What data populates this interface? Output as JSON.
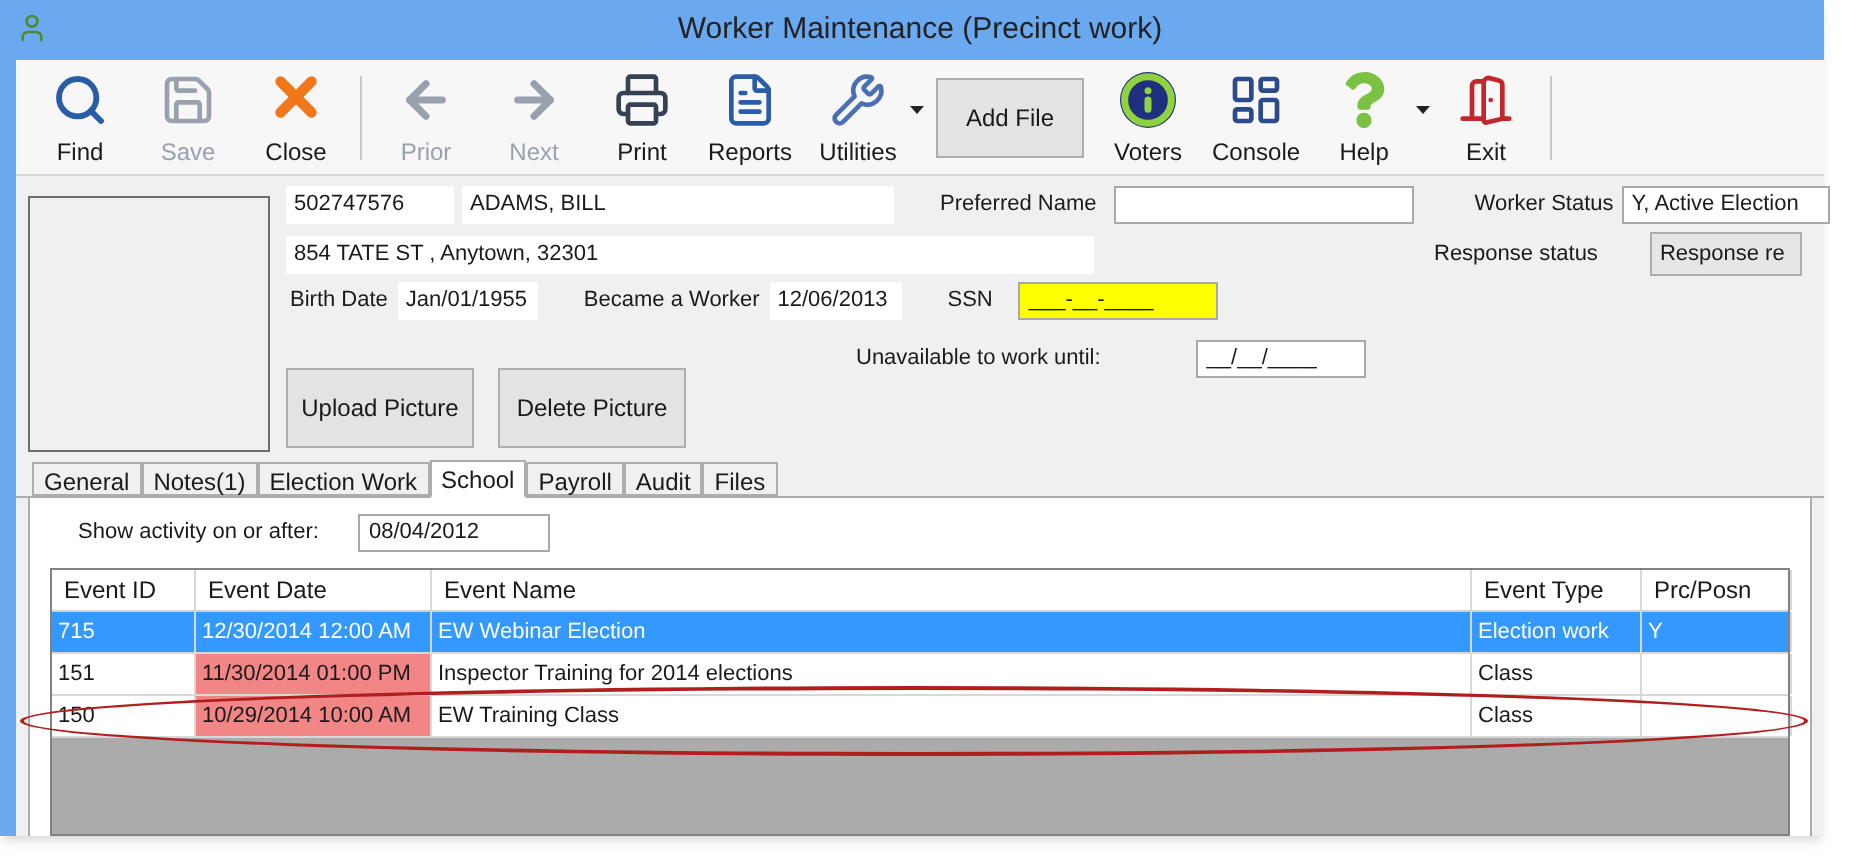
{
  "window": {
    "title": "Worker Maintenance (Precinct work)"
  },
  "toolbar": [
    {
      "kind": "find",
      "label": "Find",
      "disabled": false
    },
    {
      "kind": "save",
      "label": "Save",
      "disabled": true
    },
    {
      "kind": "close",
      "label": "Close",
      "disabled": false
    },
    {
      "kind": "separator"
    },
    {
      "kind": "prior",
      "label": "Prior",
      "disabled": true
    },
    {
      "kind": "next",
      "label": "Next",
      "disabled": true
    },
    {
      "kind": "print",
      "label": "Print",
      "disabled": false
    },
    {
      "kind": "reports",
      "label": "Reports",
      "disabled": false
    },
    {
      "kind": "utilities",
      "label": "Utilities",
      "disabled": false,
      "dropdown": true
    },
    {
      "kind": "button",
      "label": "Add File"
    },
    {
      "kind": "voters",
      "label": "Voters",
      "disabled": false
    },
    {
      "kind": "console",
      "label": "Console",
      "disabled": false
    },
    {
      "kind": "help",
      "label": "Help",
      "disabled": false,
      "dropdown": true
    },
    {
      "kind": "exit",
      "label": "Exit",
      "disabled": false
    },
    {
      "kind": "separator"
    }
  ],
  "worker": {
    "id": "502747576",
    "name": "ADAMS, BILL",
    "address": "854 TATE ST , Anytown, 32301",
    "birth_date_label": "Birth Date",
    "birth_date": "Jan/01/1955",
    "became_label": "Became a Worker",
    "became": "12/06/2013",
    "ssn_label": "SSN",
    "ssn": "___-__-____",
    "preferred_label": "Preferred Name",
    "status_label": "Worker Status",
    "status": "Y, Active Election",
    "response_label": "Response status",
    "response": "Response re",
    "unavailable_label": "Unavailable to work until:",
    "unavailable": "__/__/____"
  },
  "picture_buttons": [
    "Upload Picture",
    "Delete Picture"
  ],
  "tabs": [
    {
      "label": "General",
      "selected": false
    },
    {
      "label": "Notes(1)",
      "selected": false
    },
    {
      "label": "Election Work",
      "selected": false
    },
    {
      "label": "School",
      "selected": true
    },
    {
      "label": "Payroll",
      "selected": false
    },
    {
      "label": "Audit",
      "selected": false
    },
    {
      "label": "Files",
      "selected": false
    }
  ],
  "filter": {
    "label": "Show activity on or after:",
    "value": "08/04/2012"
  },
  "table": {
    "columns": [
      "Event ID",
      "Event Date",
      "Event Name",
      "Event Type",
      "Prc/Posn"
    ],
    "rows": [
      {
        "cells": [
          "715",
          "12/30/2014 12:00 AM",
          "EW Webinar Election",
          "Election work",
          "Y"
        ],
        "selected": true,
        "date_flag": false,
        "circled": false
      },
      {
        "cells": [
          "151",
          "11/30/2014 01:00 PM",
          "Inspector Training for 2014 elections",
          "Class",
          ""
        ],
        "selected": false,
        "date_flag": true,
        "circled": false
      },
      {
        "cells": [
          "150",
          "10/29/2014 10:00 AM",
          "EW Training Class",
          "Class",
          ""
        ],
        "selected": false,
        "date_flag": true,
        "circled": true
      }
    ]
  }
}
